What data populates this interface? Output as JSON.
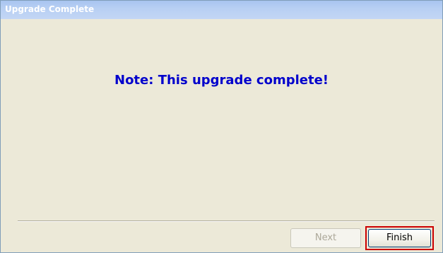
{
  "window": {
    "title": "Upgrade Complete"
  },
  "content": {
    "note": "Note: This upgrade complete!"
  },
  "buttons": {
    "next_label": "Next",
    "finish_label": "Finish"
  },
  "colors": {
    "note_text": "#0000cc",
    "highlight_border": "#cc0000",
    "dialog_background": "#ece9d8"
  }
}
